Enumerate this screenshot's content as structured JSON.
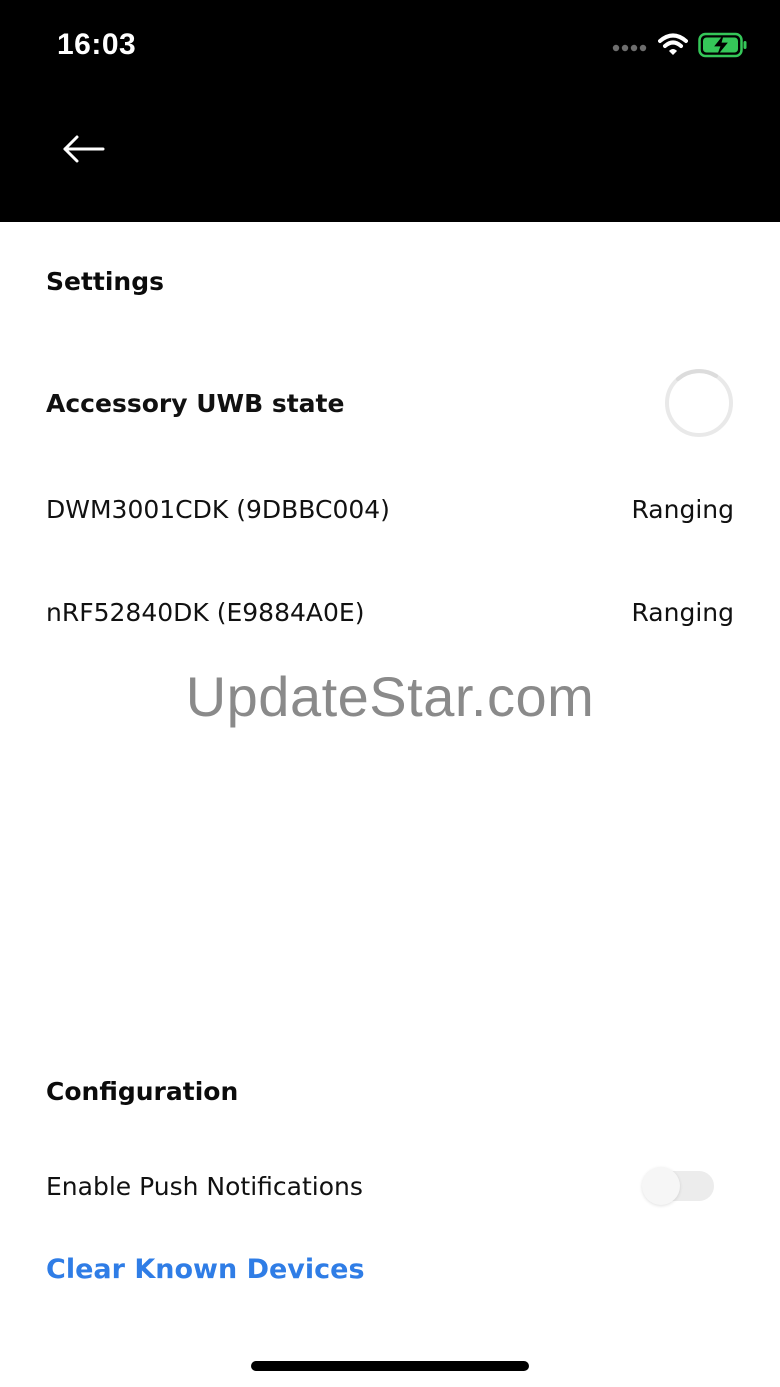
{
  "status_bar": {
    "time": "16:03",
    "icons": [
      "signal-dots-icon",
      "wifi-icon",
      "battery-charging-icon"
    ],
    "battery_color": "#35c759"
  },
  "nav": {
    "back_icon": "arrow-left-icon"
  },
  "settings": {
    "title": "Settings",
    "uwb_state_label": "Accessory UWB state",
    "devices": [
      {
        "name": "DWM3001CDK (9DBBC004)",
        "state": "Ranging"
      },
      {
        "name": "nRF52840DK (E9884A0E)",
        "state": "Ranging"
      }
    ]
  },
  "watermark": "UpdateStar.com",
  "configuration": {
    "title": "Configuration",
    "push_label": "Enable Push Notifications",
    "push_enabled": false,
    "clear_devices_label": "Clear Known Devices"
  },
  "colors": {
    "link": "#2f7de6",
    "header_bg": "#000000"
  }
}
